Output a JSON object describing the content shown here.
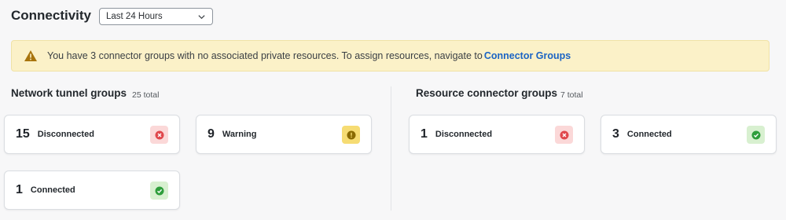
{
  "header": {
    "title": "Connectivity",
    "time_range": "Last 24 Hours"
  },
  "banner": {
    "message": "You have 3 connector groups with no associated private resources. To assign resources, navigate to",
    "link_label": "Connector Groups",
    "icon": "warning-triangle-icon"
  },
  "network_tunnel_groups": {
    "title": "Network tunnel groups",
    "total": "25 total",
    "cards": [
      {
        "count": "15",
        "label": "Disconnected",
        "status": "error"
      },
      {
        "count": "9",
        "label": "Warning",
        "status": "warning"
      },
      {
        "count": "1",
        "label": "Connected",
        "status": "ok"
      }
    ]
  },
  "resource_connector_groups": {
    "title": "Resource connector groups",
    "total": "7 total",
    "cards": [
      {
        "count": "1",
        "label": "Disconnected",
        "status": "error"
      },
      {
        "count": "3",
        "label": "Connected",
        "status": "ok"
      }
    ]
  },
  "colors": {
    "error": "#e0474c",
    "warning": "#8a6a00",
    "ok": "#2f9e3c",
    "link": "#1b64c4",
    "banner_bg": "#fbf1c8"
  }
}
